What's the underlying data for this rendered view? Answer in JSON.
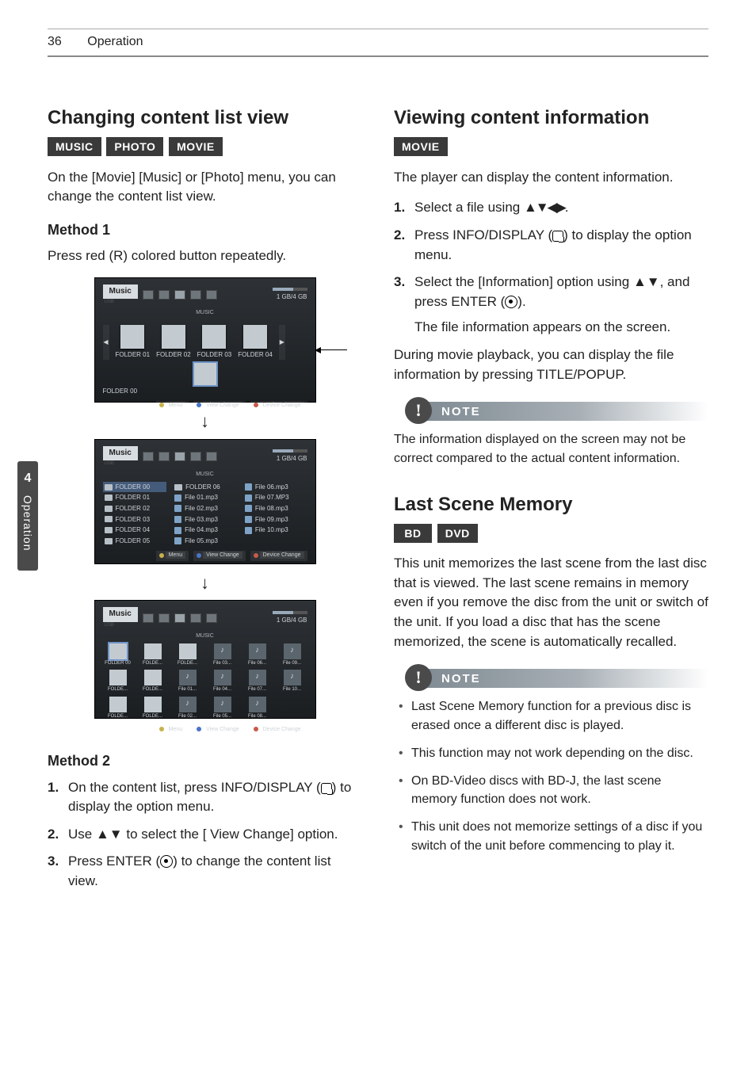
{
  "page": {
    "number": "36",
    "section": "Operation"
  },
  "sidebar": {
    "chapter": "4",
    "label": "Operation"
  },
  "left": {
    "h_changing": "Changing content list view",
    "badges": [
      "MUSIC",
      "PHOTO",
      "MOVIE"
    ],
    "intro": "On the [Movie] [Music] or [Photo] menu, you can change the content list view.",
    "method1_h": "Method 1",
    "method1_p": "Press red (R) colored button repeatedly.",
    "method2_h": "Method 2",
    "m2_s1_num": "1.",
    "m2_s1": "On the content list, press INFO/DISPLAY (",
    "m2_s1_after": ") to display the option menu.",
    "m2_s2_num": "2.",
    "m2_s2_a": "Use ",
    "m2_s2_b": " to select the [ View Change] option.",
    "m2_s3_num": "3.",
    "m2_s3_a": "Press ENTER (",
    "m2_s3_b": ") to change the content list view."
  },
  "right": {
    "h_viewing": "Viewing content information",
    "badges_viewing": [
      "MOVIE"
    ],
    "viewing_p": "The player can display the content information.",
    "v_s1_num": "1.",
    "v_s1_a": "Select a file using",
    "v_s1_b": ".",
    "v_s2_num": "2.",
    "v_s2_a": "Press INFO/DISPLAY (",
    "v_s2_b": ") to display the option menu.",
    "v_s3_num": "3.",
    "v_s3_a": "Select the [Information] option using ",
    "v_s3_b": ", and press ENTER (",
    "v_s3_c": ").",
    "v_s3_sub": "The file information appears on the screen.",
    "viewing_p2": "During movie playback, you can display the file information by pressing TITLE/POPUP.",
    "note_label": "NOTE",
    "note1_body": "The information displayed on the screen may not be correct compared to the actual content information.",
    "h_last": "Last Scene Memory",
    "badges_last": [
      "BD",
      "DVD"
    ],
    "last_p": "This unit memorizes the last scene from the last disc that is viewed. The last scene remains in memory even if you remove the disc from the unit or switch of the unit. If you load a disc that has the scene memorized, the scene is automatically recalled.",
    "note2_items": [
      "Last Scene Memory function for a previous disc is erased once a different disc is played.",
      "This function may not work depending on the disc.",
      "On BD-Video discs with BD-J, the last scene memory function does not work.",
      "This unit does not memorize settings of a disc if you switch of the unit before commencing to play it."
    ]
  },
  "glyphs": {
    "updown": "▲▼",
    "quad": "▲▼◀▶",
    "down": "↓"
  },
  "shot_common": {
    "title": "Music",
    "subtitle": "USB",
    "tab_label": "MUSIC",
    "storage": "1 GB/4 GB",
    "opt_menu": "Menu",
    "opt_view": "View Change",
    "opt_dev": "Device Change"
  },
  "shot1": {
    "folders": [
      "FOLDER 01",
      "FOLDER 02",
      "FOLDER 03",
      "FOLDER 04"
    ],
    "current": "FOLDER 00"
  },
  "shot2": {
    "colA": [
      "FOLDER 00",
      "FOLDER 01",
      "FOLDER 02",
      "FOLDER 03",
      "FOLDER 04",
      "FOLDER 05"
    ],
    "colB": [
      "FOLDER 06",
      "File 01.mp3",
      "File 02.mp3",
      "File 03.mp3",
      "File 04.mp3",
      "File 05.mp3"
    ],
    "colC": [
      "File 06.mp3",
      "File 07.MP3",
      "File 08.mp3",
      "File 09.mp3",
      "File 10.mp3",
      ""
    ]
  },
  "shot3": {
    "row1": [
      {
        "t": "f",
        "l": "FOLDER 00",
        "sel": true
      },
      {
        "t": "f",
        "l": "FOLDE..."
      },
      {
        "t": "f",
        "l": "FOLDE..."
      },
      {
        "t": "m",
        "l": "File 03..."
      },
      {
        "t": "m",
        "l": "File 06..."
      },
      {
        "t": "m",
        "l": "File 09..."
      }
    ],
    "row2": [
      {
        "t": "f",
        "l": "FOLDE..."
      },
      {
        "t": "f",
        "l": "FOLDE..."
      },
      {
        "t": "m",
        "l": "File 01..."
      },
      {
        "t": "m",
        "l": "File 04..."
      },
      {
        "t": "m",
        "l": "File 07..."
      },
      {
        "t": "m",
        "l": "File 10..."
      }
    ],
    "row3": [
      {
        "t": "f",
        "l": "FOLDE..."
      },
      {
        "t": "f",
        "l": "FOLDE..."
      },
      {
        "t": "m",
        "l": "File 02..."
      },
      {
        "t": "m",
        "l": "File 05..."
      },
      {
        "t": "m",
        "l": "File 08..."
      }
    ]
  }
}
